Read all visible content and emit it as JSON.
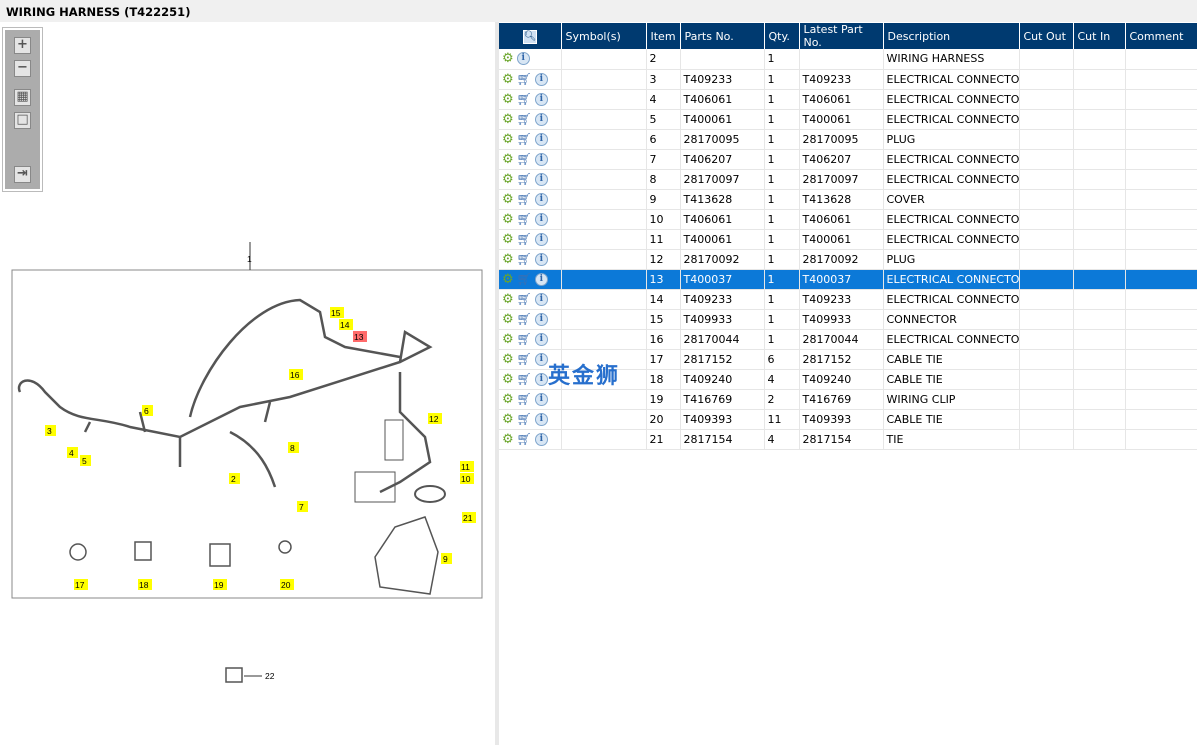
{
  "title": "WIRING HARNESS (T422251)",
  "toolbar": {
    "zoom_in": "+",
    "zoom_out": "−",
    "fit": "▦",
    "actual": "□",
    "toggle": "⇥"
  },
  "diagram": {
    "callouts": [
      "1",
      "2",
      "3",
      "4",
      "5",
      "6",
      "7",
      "8",
      "9",
      "10",
      "11",
      "12",
      "13",
      "14",
      "15",
      "16",
      "17",
      "18",
      "19",
      "20",
      "21",
      "22"
    ],
    "highlight_color": "#ffff00",
    "selected_color": "#ff6b6b"
  },
  "watermark": "英金狮",
  "table": {
    "headers": [
      "",
      "Symbol(s)",
      "Item",
      "Parts No.",
      "Qty.",
      "Latest Part No.",
      "Description",
      "Cut Out",
      "Cut In",
      "Comment"
    ],
    "rows": [
      {
        "item": "2",
        "part": "",
        "qty": "1",
        "latest": "",
        "desc": "WIRING HARNESS",
        "cart": false
      },
      {
        "item": "3",
        "part": "T409233",
        "qty": "1",
        "latest": "T409233",
        "desc": "ELECTRICAL CONNECTOR",
        "cart": true
      },
      {
        "item": "4",
        "part": "T406061",
        "qty": "1",
        "latest": "T406061",
        "desc": "ELECTRICAL CONNECTOR",
        "cart": true
      },
      {
        "item": "5",
        "part": "T400061",
        "qty": "1",
        "latest": "T400061",
        "desc": "ELECTRICAL CONNECTOR",
        "cart": true
      },
      {
        "item": "6",
        "part": "28170095",
        "qty": "1",
        "latest": "28170095",
        "desc": "PLUG",
        "cart": true
      },
      {
        "item": "7",
        "part": "T406207",
        "qty": "1",
        "latest": "T406207",
        "desc": "ELECTRICAL CONNECTOR",
        "cart": true
      },
      {
        "item": "8",
        "part": "28170097",
        "qty": "1",
        "latest": "28170097",
        "desc": "ELECTRICAL CONNECTOR",
        "cart": true
      },
      {
        "item": "9",
        "part": "T413628",
        "qty": "1",
        "latest": "T413628",
        "desc": "COVER",
        "cart": true
      },
      {
        "item": "10",
        "part": "T406061",
        "qty": "1",
        "latest": "T406061",
        "desc": "ELECTRICAL CONNECTOR",
        "cart": true
      },
      {
        "item": "11",
        "part": "T400061",
        "qty": "1",
        "latest": "T400061",
        "desc": "ELECTRICAL CONNECTOR",
        "cart": true
      },
      {
        "item": "12",
        "part": "28170092",
        "qty": "1",
        "latest": "28170092",
        "desc": "PLUG",
        "cart": true
      },
      {
        "item": "13",
        "part": "T400037",
        "qty": "1",
        "latest": "T400037",
        "desc": "ELECTRICAL CONNECTOR",
        "cart": true,
        "selected": true
      },
      {
        "item": "14",
        "part": "T409233",
        "qty": "1",
        "latest": "T409233",
        "desc": "ELECTRICAL CONNECTOR",
        "cart": true
      },
      {
        "item": "15",
        "part": "T409933",
        "qty": "1",
        "latest": "T409933",
        "desc": "CONNECTOR",
        "cart": true
      },
      {
        "item": "16",
        "part": "28170044",
        "qty": "1",
        "latest": "28170044",
        "desc": "ELECTRICAL CONNECTOR",
        "cart": true
      },
      {
        "item": "17",
        "part": "2817152",
        "qty": "6",
        "latest": "2817152",
        "desc": "CABLE TIE",
        "cart": true
      },
      {
        "item": "18",
        "part": "T409240",
        "qty": "4",
        "latest": "T409240",
        "desc": "CABLE TIE",
        "cart": true
      },
      {
        "item": "19",
        "part": "T416769",
        "qty": "2",
        "latest": "T416769",
        "desc": "WIRING CLIP",
        "cart": true
      },
      {
        "item": "20",
        "part": "T409393",
        "qty": "11",
        "latest": "T409393",
        "desc": "CABLE TIE",
        "cart": true
      },
      {
        "item": "21",
        "part": "2817154",
        "qty": "4",
        "latest": "2817154",
        "desc": "TIE",
        "cart": true
      }
    ]
  }
}
